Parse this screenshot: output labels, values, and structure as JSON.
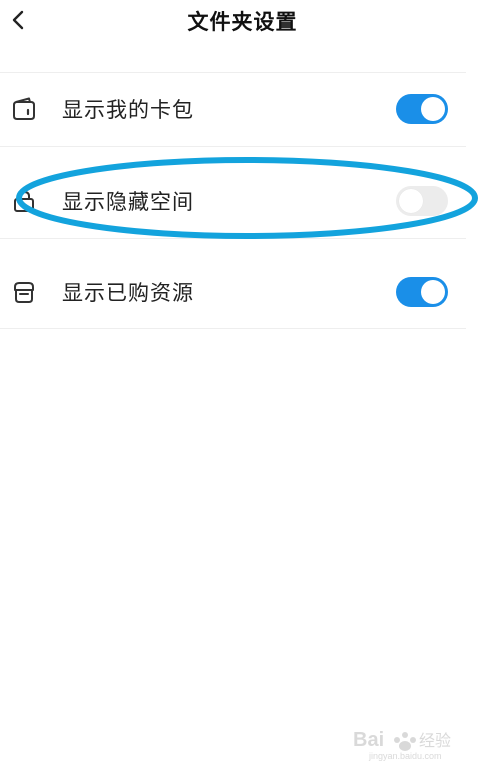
{
  "header": {
    "title": "文件夹设置",
    "back_icon": "chevron-left-icon"
  },
  "settings": [
    {
      "label": "显示我的卡包",
      "icon": "wallet-icon",
      "enabled": true
    },
    {
      "label": "显示隐藏空间",
      "icon": "lock-icon",
      "enabled": false
    },
    {
      "label": "显示已购资源",
      "icon": "store-icon",
      "enabled": true
    }
  ],
  "colors": {
    "accent": "#1a8fe8",
    "toggle_off": "#ececec",
    "highlight_ellipse": "#13a3dd"
  },
  "watermark": {
    "text": "Bai 经验",
    "subtext": "jingyan.baidu.com"
  }
}
